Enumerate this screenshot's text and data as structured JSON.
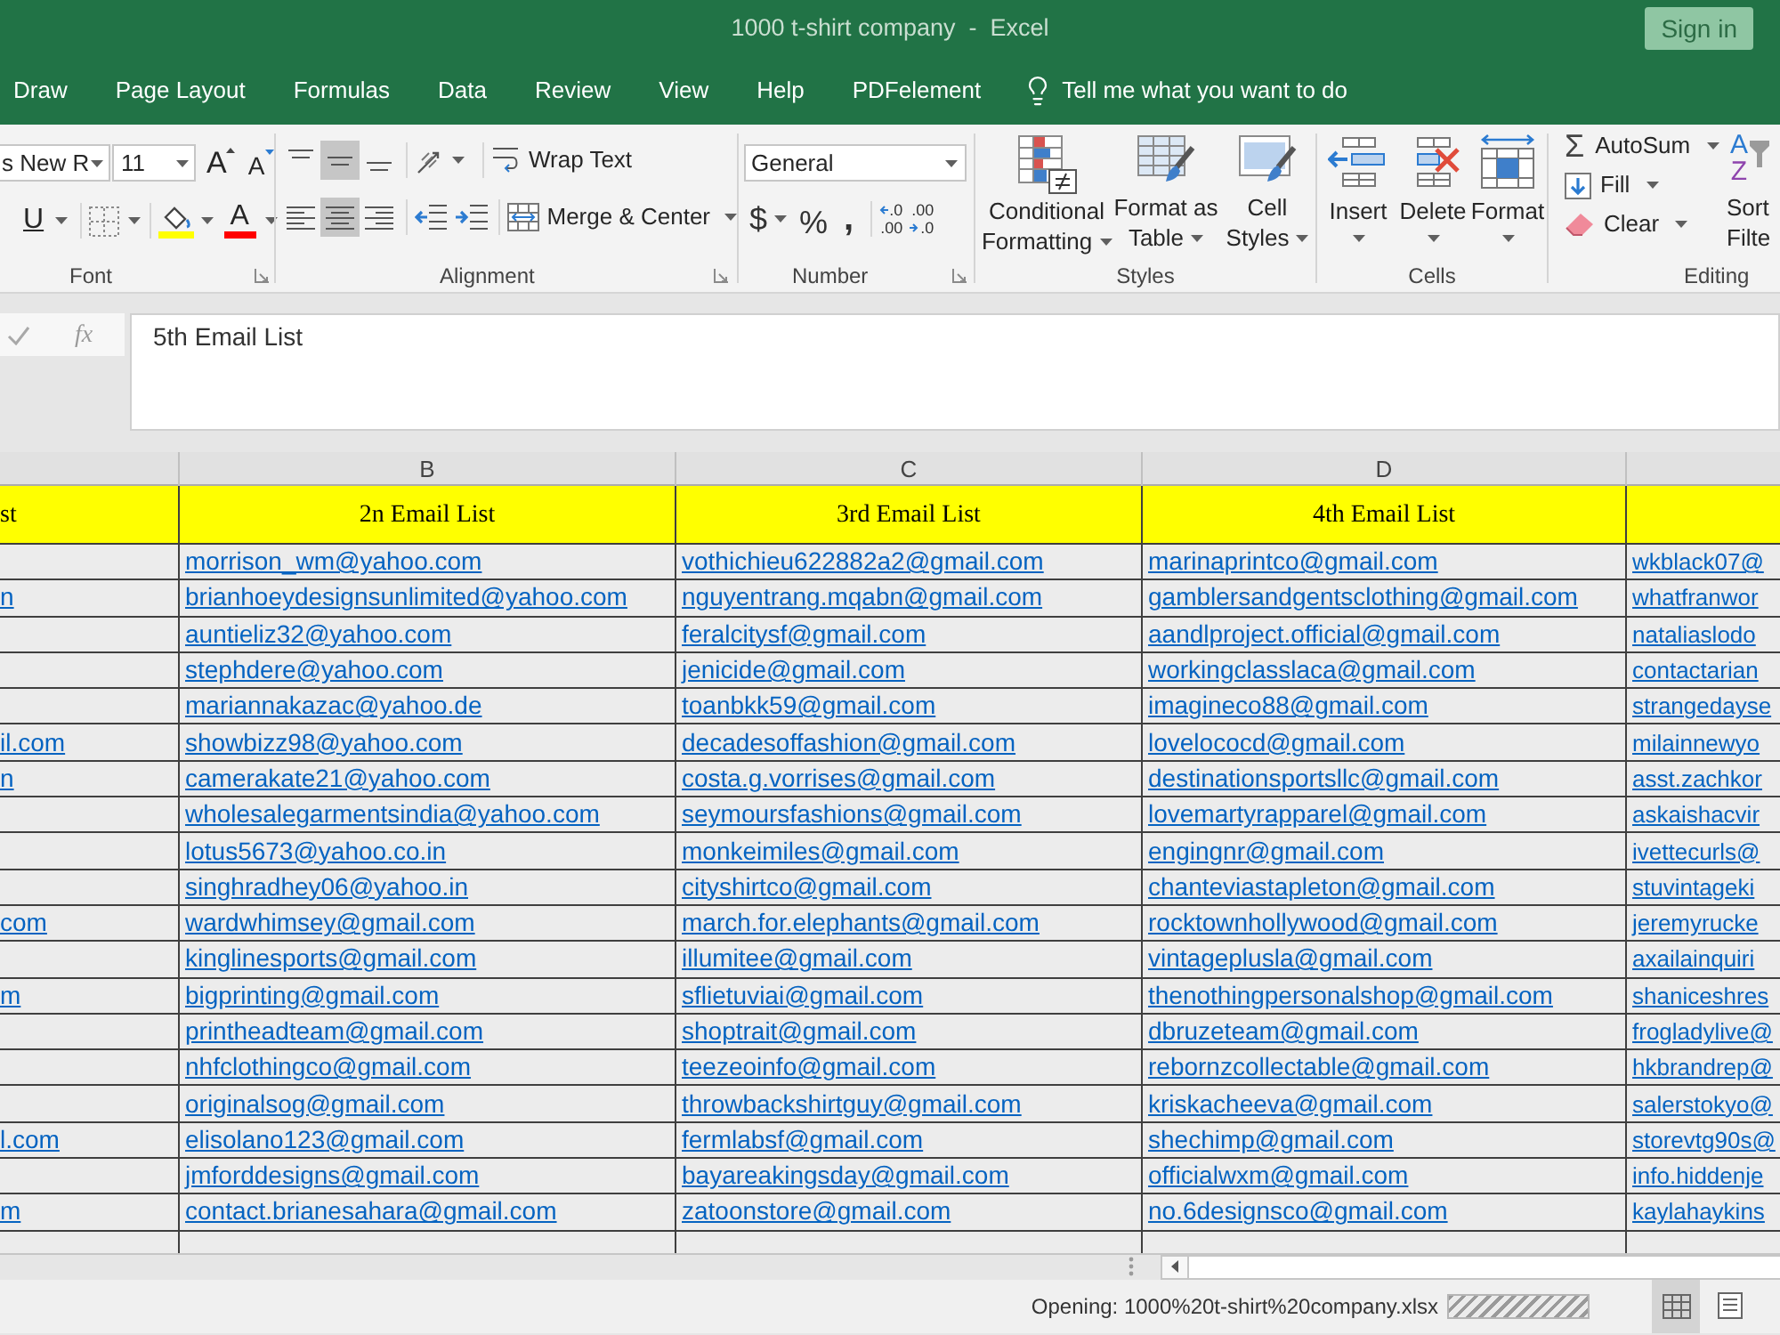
{
  "window": {
    "title": "1000 t-shirt company  -  Excel",
    "sign_in": "Sign in"
  },
  "menu_tabs": [
    {
      "label": "Draw",
      "selected": false
    },
    {
      "label": "Page Layout",
      "selected": false
    },
    {
      "label": "Formulas",
      "selected": false
    },
    {
      "label": "Data",
      "selected": false
    },
    {
      "label": "Review",
      "selected": false
    },
    {
      "label": "View",
      "selected": false
    },
    {
      "label": "Help",
      "selected": false
    },
    {
      "label": "PDFelement",
      "selected": false
    }
  ],
  "tell_me": "Tell me what you want to do",
  "font_group": {
    "label": "Font",
    "font_name": "s New R",
    "font_size": "11",
    "grow": "A",
    "shrink": "A",
    "underline": "U",
    "font_color": "A"
  },
  "alignment_group": {
    "label": "Alignment",
    "vertical": [
      {
        "kind": "top",
        "selected": false
      },
      {
        "kind": "middle",
        "selected": true
      },
      {
        "kind": "bottom",
        "selected": false
      }
    ],
    "horizontal": [
      {
        "kind": "left",
        "selected": false
      },
      {
        "kind": "center",
        "selected": true
      },
      {
        "kind": "right",
        "selected": false
      }
    ],
    "wrap_text": "Wrap Text",
    "merge": "Merge & Center"
  },
  "number_group": {
    "label": "Number",
    "format": "General",
    "currency": "$",
    "percent": "%",
    "comma": ",",
    "decimal_buttons": [
      {
        "kind": "increase",
        "lines": [
          ".0",
          ".00"
        ]
      },
      {
        "kind": "decrease",
        "lines": [
          ".00",
          ".0"
        ]
      }
    ]
  },
  "styles_group": {
    "label": "Styles",
    "buttons": [
      {
        "kind": "conditional",
        "lines": [
          "Conditional",
          "Formatting"
        ]
      },
      {
        "kind": "table",
        "lines": [
          "Format as",
          "Table"
        ]
      },
      {
        "kind": "cell_styles",
        "lines": [
          "Cell",
          "Styles"
        ]
      }
    ]
  },
  "cells_group": {
    "label": "Cells",
    "buttons": [
      {
        "kind": "insert",
        "label": "Insert"
      },
      {
        "kind": "delete",
        "label": "Delete"
      },
      {
        "kind": "format",
        "label": "Format"
      }
    ]
  },
  "editing_group": {
    "label": "Editing",
    "items": [
      {
        "kind": "autosum",
        "glyph": "Σ",
        "label": "AutoSum"
      },
      {
        "kind": "fill",
        "label": "Fill"
      },
      {
        "kind": "clear",
        "label": "Clear"
      }
    ],
    "sort": {
      "glyphs": [
        "A",
        "Z"
      ],
      "lines": [
        "Sort",
        "Filte"
      ]
    }
  },
  "formula_bar": {
    "function_glyph": "fx",
    "value": "5th Email List"
  },
  "sheet": {
    "columns": [
      {
        "header": "st"
      },
      {
        "letter": "B",
        "header": "2n Email List"
      },
      {
        "letter": "C",
        "header": "3rd Email List"
      },
      {
        "letter": "D",
        "header": "4th Email List"
      },
      {}
    ],
    "rows": [
      [
        null,
        "morrison_wm@yahoo.com",
        "vothichieu622882a2@gmail.com",
        "marinaprintco@gmail.com",
        "wkblack07@"
      ],
      [
        "n",
        "brianhoeydesignsunlimited@yahoo.com",
        "nguyentrang.mqabn@gmail.com",
        "gamblersandgentsclothing@gmail.com",
        "whatfranwor"
      ],
      [
        null,
        "auntieliz32@yahoo.com",
        "feralcitysf@gmail.com",
        "aandlproject.official@gmail.com",
        "nataliaslodo"
      ],
      [
        null,
        "stephdere@yahoo.com",
        "jenicide@gmail.com",
        "workingclasslaca@gmail.com",
        "contactarian"
      ],
      [
        null,
        "mariannakazac@yahoo.de",
        "toanbkk59@gmail.com",
        "imagineco88@gmail.com",
        "strangedayse"
      ],
      [
        "il.com",
        "showbizz98@yahoo.com",
        "decadesoffashion@gmail.com",
        "lovelococd@gmail.com",
        "milainnewyo"
      ],
      [
        "n",
        "camerakate21@yahoo.com",
        "costa.g.vorrises@gmail.com",
        "destinationsportsllc@gmail.com",
        "asst.zachkor"
      ],
      [
        null,
        "wholesalegarmentsindia@yahoo.com",
        "seymoursfashions@gmail.com",
        "lovemartyrapparel@gmail.com",
        "askaishacvir"
      ],
      [
        null,
        "lotus5673@yahoo.co.in",
        "monkeimiles@gmail.com",
        "engingnr@gmail.com",
        "ivettecurls@"
      ],
      [
        null,
        "singhradhey06@yahoo.in",
        "cityshirtco@gmail.com",
        "chanteviastapleton@gmail.com",
        "stuvintageki"
      ],
      [
        "com",
        "wardwhimsey@gmail.com",
        "march.for.elephants@gmail.com",
        "rocktownhollywood@gmail.com",
        "jeremyrucke"
      ],
      [
        null,
        "kinglinesports@gmail.com",
        "illumitee@gmail.com",
        "vintageplusla@gmail.com",
        "axailainquiri"
      ],
      [
        "m",
        "bigprinting@gmail.com",
        "sflietuviai@gmail.com",
        "thenothingpersonalshop@gmail.com",
        "shaniceshres"
      ],
      [
        null,
        "printheadteam@gmail.com",
        "shoptrait@gmail.com",
        "dbruzeteam@gmail.com",
        "frogladylive@"
      ],
      [
        null,
        "nhfclothingco@gmail.com",
        "teezeoinfo@gmail.com",
        "rebornzcollectable@gmail.com",
        "hkbrandrep@"
      ],
      [
        null,
        "originalsog@gmail.com",
        "throwbackshirtguy@gmail.com",
        "kriskacheeva@gmail.com",
        "salerstokyo@"
      ],
      [
        "l.com",
        "elisolano123@gmail.com",
        "fermlabsf@gmail.com",
        "shechimp@gmail.com",
        "storevtg90s@"
      ],
      [
        null,
        "jmforddesigns@gmail.com",
        "bayareakingsday@gmail.com",
        "officialwxm@gmail.com",
        "info.hiddenje"
      ],
      [
        "m",
        "contact.brianesahara@gmail.com",
        "zatoonstore@gmail.com",
        "no.6designsco@gmail.com",
        "kaylahaykins"
      ]
    ]
  },
  "status_bar": {
    "text": "Opening: 1000%20t-shirt%20company.xlsx",
    "progress": {
      "level": 1
    },
    "views": [
      {
        "kind": "normal",
        "selected": true
      },
      {
        "kind": "page_layout",
        "selected": false
      }
    ]
  }
}
